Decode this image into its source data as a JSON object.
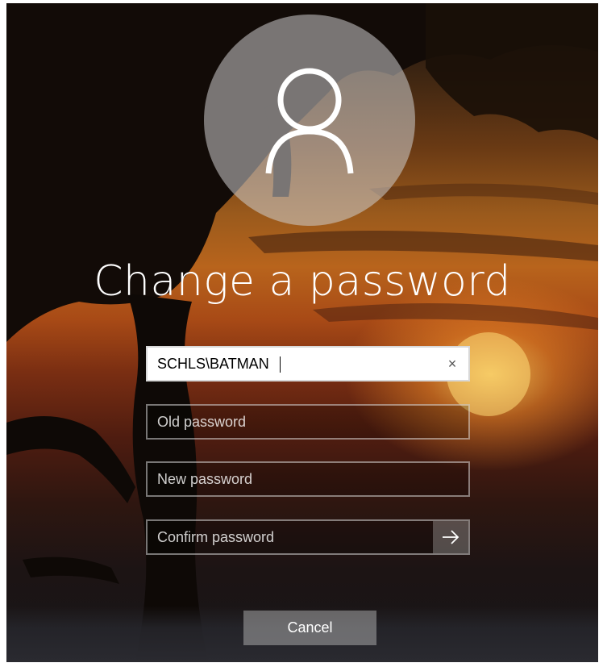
{
  "screen": {
    "title": "Change a password",
    "background_colors": {
      "sky_top": "#1a120c",
      "sun_glow": "#f0a030",
      "horizon": "#2a2a30"
    }
  },
  "avatar": {
    "icon": "user-icon"
  },
  "form": {
    "username": {
      "value": "SCHLS\\BATMAN",
      "clear_icon": "close-icon",
      "clear_label": "×"
    },
    "old_password": {
      "placeholder": "Old password",
      "value": ""
    },
    "new_password": {
      "placeholder": "New password",
      "value": ""
    },
    "confirm_password": {
      "placeholder": "Confirm password",
      "value": "",
      "submit_icon": "arrow-right-icon"
    }
  },
  "actions": {
    "cancel_label": "Cancel"
  }
}
